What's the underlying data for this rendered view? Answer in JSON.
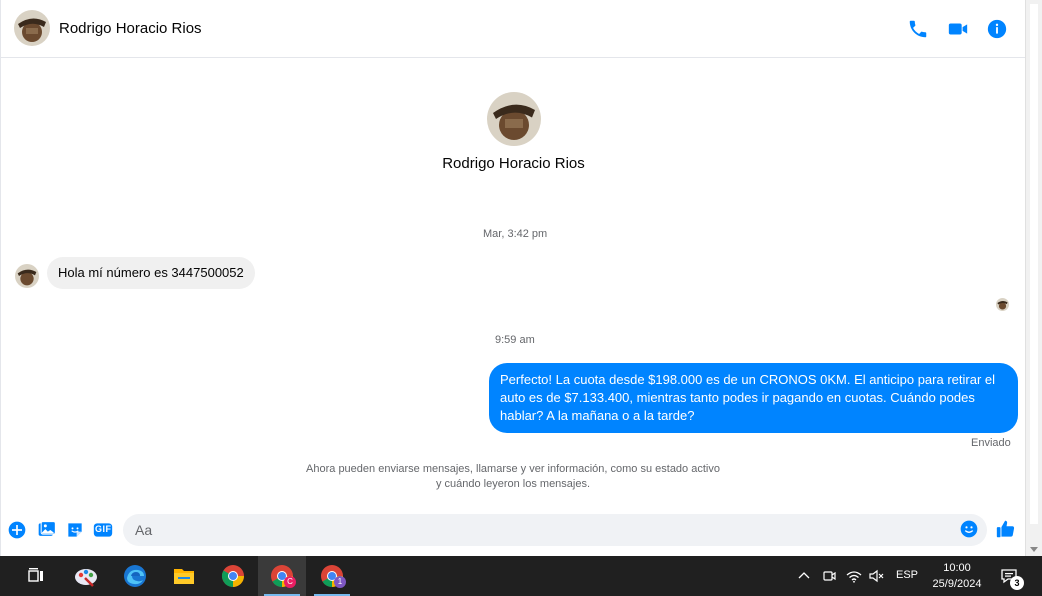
{
  "header": {
    "contact_name": "Rodrigo Horacio Rios",
    "icons": [
      "phone-icon",
      "video-call-icon",
      "info-icon"
    ],
    "accent_color": "#0084ff"
  },
  "profile": {
    "name": "Rodrigo Horacio Rios"
  },
  "conversation": {
    "timestamp_1": "Mar, 3:42 pm",
    "incoming_message": "Hola mí número es 3447500052",
    "timestamp_2": "9:59 am",
    "outgoing_message": "Perfecto! La cuota desde $198.000 es de un CRONOS 0KM. El anticipo para retirar el auto es de $7.133.400, mientras tanto podes ir pagando en cuotas. Cuándo podes hablar? A la mañana o a la tarde?",
    "status": "Enviado",
    "notice_line1": "Ahora pueden enviarse mensajes, llamarse y ver información, como su estado activo",
    "notice_line2": "y cuándo leyeron los mensajes."
  },
  "composer": {
    "placeholder": "Aa",
    "icons": [
      "plus-icon",
      "gallery-icon",
      "sticker-icon",
      "gif-icon",
      "emoji-icon",
      "like-icon"
    ],
    "gif_label": "GIF"
  },
  "taskbar": {
    "apps": [
      "task-view-icon",
      "paint-app-icon",
      "edge-icon",
      "file-explorer-icon",
      "chrome-icon",
      "chrome-profile-c-icon",
      "chrome-profile-2-icon"
    ],
    "profile_c_badge": "C",
    "profile_2_badge": "1",
    "language": "ESP",
    "time": "10:00",
    "date": "25/9/2024",
    "notification_count": "3"
  }
}
